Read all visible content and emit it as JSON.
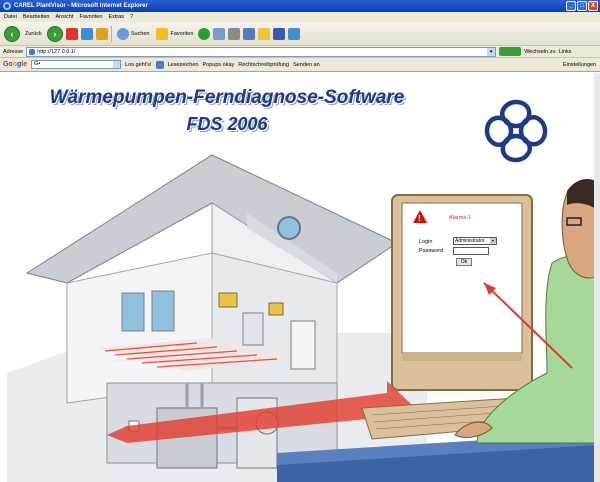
{
  "window": {
    "title": "CAREL PlantVisor - Microsoft Internet Explorer",
    "buttons": [
      "_",
      "□",
      "X"
    ]
  },
  "menu": [
    "Datei",
    "Bearbeiten",
    "Ansicht",
    "Favoriten",
    "Extras",
    "?"
  ],
  "toolbar": {
    "back_label": "Zurück",
    "search_label": "Suchen",
    "favorites_label": "Favoriten"
  },
  "address": {
    "label": "Adresse",
    "value": "http://127.0.0.1/",
    "go_label": "Wechseln zu",
    "links_label": "Links"
  },
  "google_bar": {
    "logo": [
      "G",
      "o",
      "o",
      "g",
      "l",
      "e"
    ],
    "search_value": "G•",
    "go_label": "Los geht's!",
    "bookmarks_label": "Lesezeichen",
    "popups_label": "Popups okay",
    "spellcheck_label": "Rechtschreibprüfung",
    "send_label": "Senden an",
    "settings_label": "Einstellungen"
  },
  "page": {
    "headline": "Wärmepumpen-Ferndiagnose-Software",
    "subheadline": "FDS 2006"
  },
  "login_dialog": {
    "alarm_text": "Alarms-1",
    "login_label": "Login",
    "login_value": "Administrator",
    "password_label": "Password",
    "ok_label": "Ok"
  },
  "colors": {
    "headline": "#1d3a88",
    "titlebar": "#0b3fb6",
    "alarm": "#d22222",
    "arrow": "#e33a2a"
  }
}
